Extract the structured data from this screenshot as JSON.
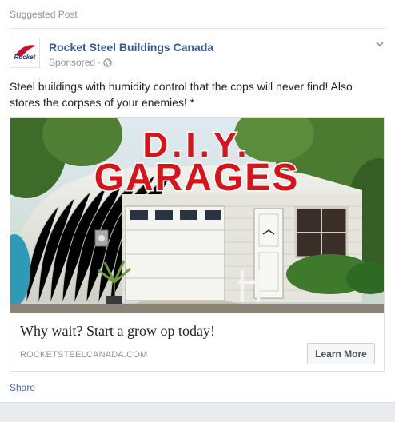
{
  "header": {
    "suggested_label": "Suggested Post"
  },
  "page": {
    "name": "Rocket Steel Buildings Canada",
    "sponsored": "Sponsored",
    "logo_text": "Rocket"
  },
  "post": {
    "text": "Steel buildings with humidity control that the cops will never find! Also stores the corpses of your enemies! *"
  },
  "ad": {
    "image_title_top": "D.I.Y.",
    "image_title_bottom": "GARAGES",
    "headline": "Why wait? Start a grow op today!",
    "domain": "ROCKETSTEELCANADA.COM",
    "cta_label": "Learn More"
  },
  "actions": {
    "share_label": "Share"
  },
  "colors": {
    "link": "#365899",
    "title_red": "#d7141a",
    "muted": "#90949c"
  }
}
